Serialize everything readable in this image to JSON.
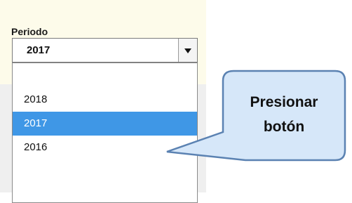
{
  "field": {
    "label": "Periodo",
    "selected_value": "2017"
  },
  "dropdown": {
    "options": [
      "2018",
      "2017",
      "2016"
    ],
    "highlighted": "2017"
  },
  "callout": {
    "line1": "Presionar",
    "line2": "botón"
  },
  "colors": {
    "highlight": "#3f97e6",
    "callout_fill": "#d6e7f9",
    "callout_border": "#5b82b2"
  },
  "icons": {
    "dropdown_arrow": "chevron-down-icon"
  }
}
